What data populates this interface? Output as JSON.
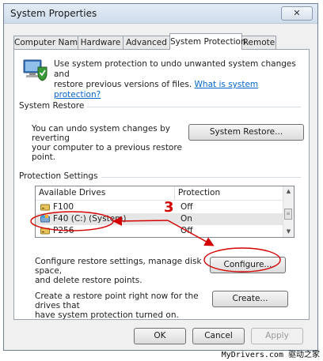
{
  "window": {
    "title": "System Properties",
    "close_label": "✕"
  },
  "tabs": [
    {
      "label": "Computer Name"
    },
    {
      "label": "Hardware"
    },
    {
      "label": "Advanced"
    },
    {
      "label": "System Protection",
      "active": true
    },
    {
      "label": "Remote"
    }
  ],
  "intro": {
    "text_line1": "Use system protection to undo unwanted system changes and",
    "text_line2": "restore previous versions of files.",
    "link": "What is system protection?"
  },
  "system_restore": {
    "heading": "System Restore",
    "desc_line1": "You can undo system changes by reverting",
    "desc_line2": "your computer to a previous restore point.",
    "button": "System Restore..."
  },
  "protection": {
    "heading": "Protection Settings",
    "columns": [
      "Available Drives",
      "Protection"
    ],
    "drives": [
      {
        "name": "F100",
        "protection": "Off",
        "icon": "drive-icon"
      },
      {
        "name": "F40 (C:) (System)",
        "protection": "On",
        "icon": "system-drive-icon",
        "selected": true
      },
      {
        "name": "P256",
        "protection": "Off",
        "icon": "drive-icon"
      }
    ],
    "configure_desc_line1": "Configure restore settings, manage disk space,",
    "configure_desc_line2": "and delete restore points.",
    "configure_button": "Configure...",
    "create_desc_line1": "Create a restore point right now for the drives that",
    "create_desc_line2": "have system protection turned on.",
    "create_button": "Create..."
  },
  "footer": {
    "ok": "OK",
    "cancel": "Cancel",
    "apply": "Apply"
  },
  "annotation": {
    "step_number": "3",
    "color": "#d40000"
  },
  "watermark": "MyDrivers.com 驱动之家"
}
